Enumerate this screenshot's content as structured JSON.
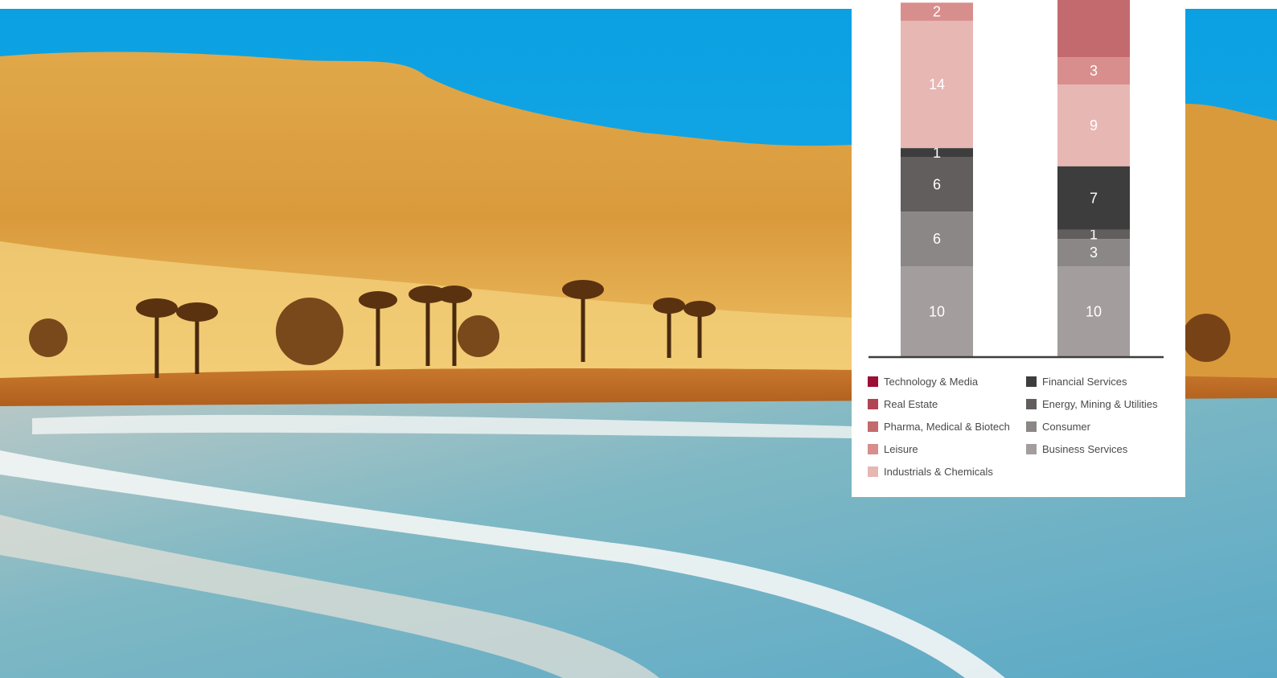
{
  "chart_data": {
    "type": "stacked-bar",
    "unit_scale_note": "",
    "categories": [
      "",
      ""
    ],
    "series": [
      {
        "name": "Business Services",
        "color": "#a39e9d",
        "values": [
          10,
          10
        ]
      },
      {
        "name": "Consumer",
        "color": "#8a8786",
        "values": [
          6,
          3
        ]
      },
      {
        "name": "Energy, Mining & Utilities",
        "color": "#615e5d",
        "values": [
          6,
          1
        ]
      },
      {
        "name": "Financial Services",
        "color": "#3d3d3d",
        "values": [
          1,
          7
        ]
      },
      {
        "name": "Industrials & Chemicals",
        "color": "#e7b7b4",
        "values": [
          14,
          9
        ]
      },
      {
        "name": "Leisure",
        "color": "#d78e8c",
        "values": [
          2,
          3
        ]
      },
      {
        "name": "Pharma, Medical & Biotech",
        "color": "#c36a6e",
        "values": [
          null,
          null
        ]
      },
      {
        "name": "Real Estate",
        "color": "#b14454",
        "values": [
          null,
          null
        ]
      },
      {
        "name": "Technology & Media",
        "color": "#9b0f35",
        "values": [
          null,
          null
        ]
      }
    ],
    "legend_left": [
      "Technology & Media",
      "Real Estate",
      "Pharma, Medical & Biotech",
      "Leisure",
      "Industrials & Chemicals"
    ],
    "legend_right": [
      "Financial Services",
      "Energy, Mining & Utilities",
      "Consumer",
      "Business Services"
    ]
  },
  "colors": {
    "second_bar_cutoff_top": "#c36a6e",
    "axis_line": "#3d3d3d"
  }
}
